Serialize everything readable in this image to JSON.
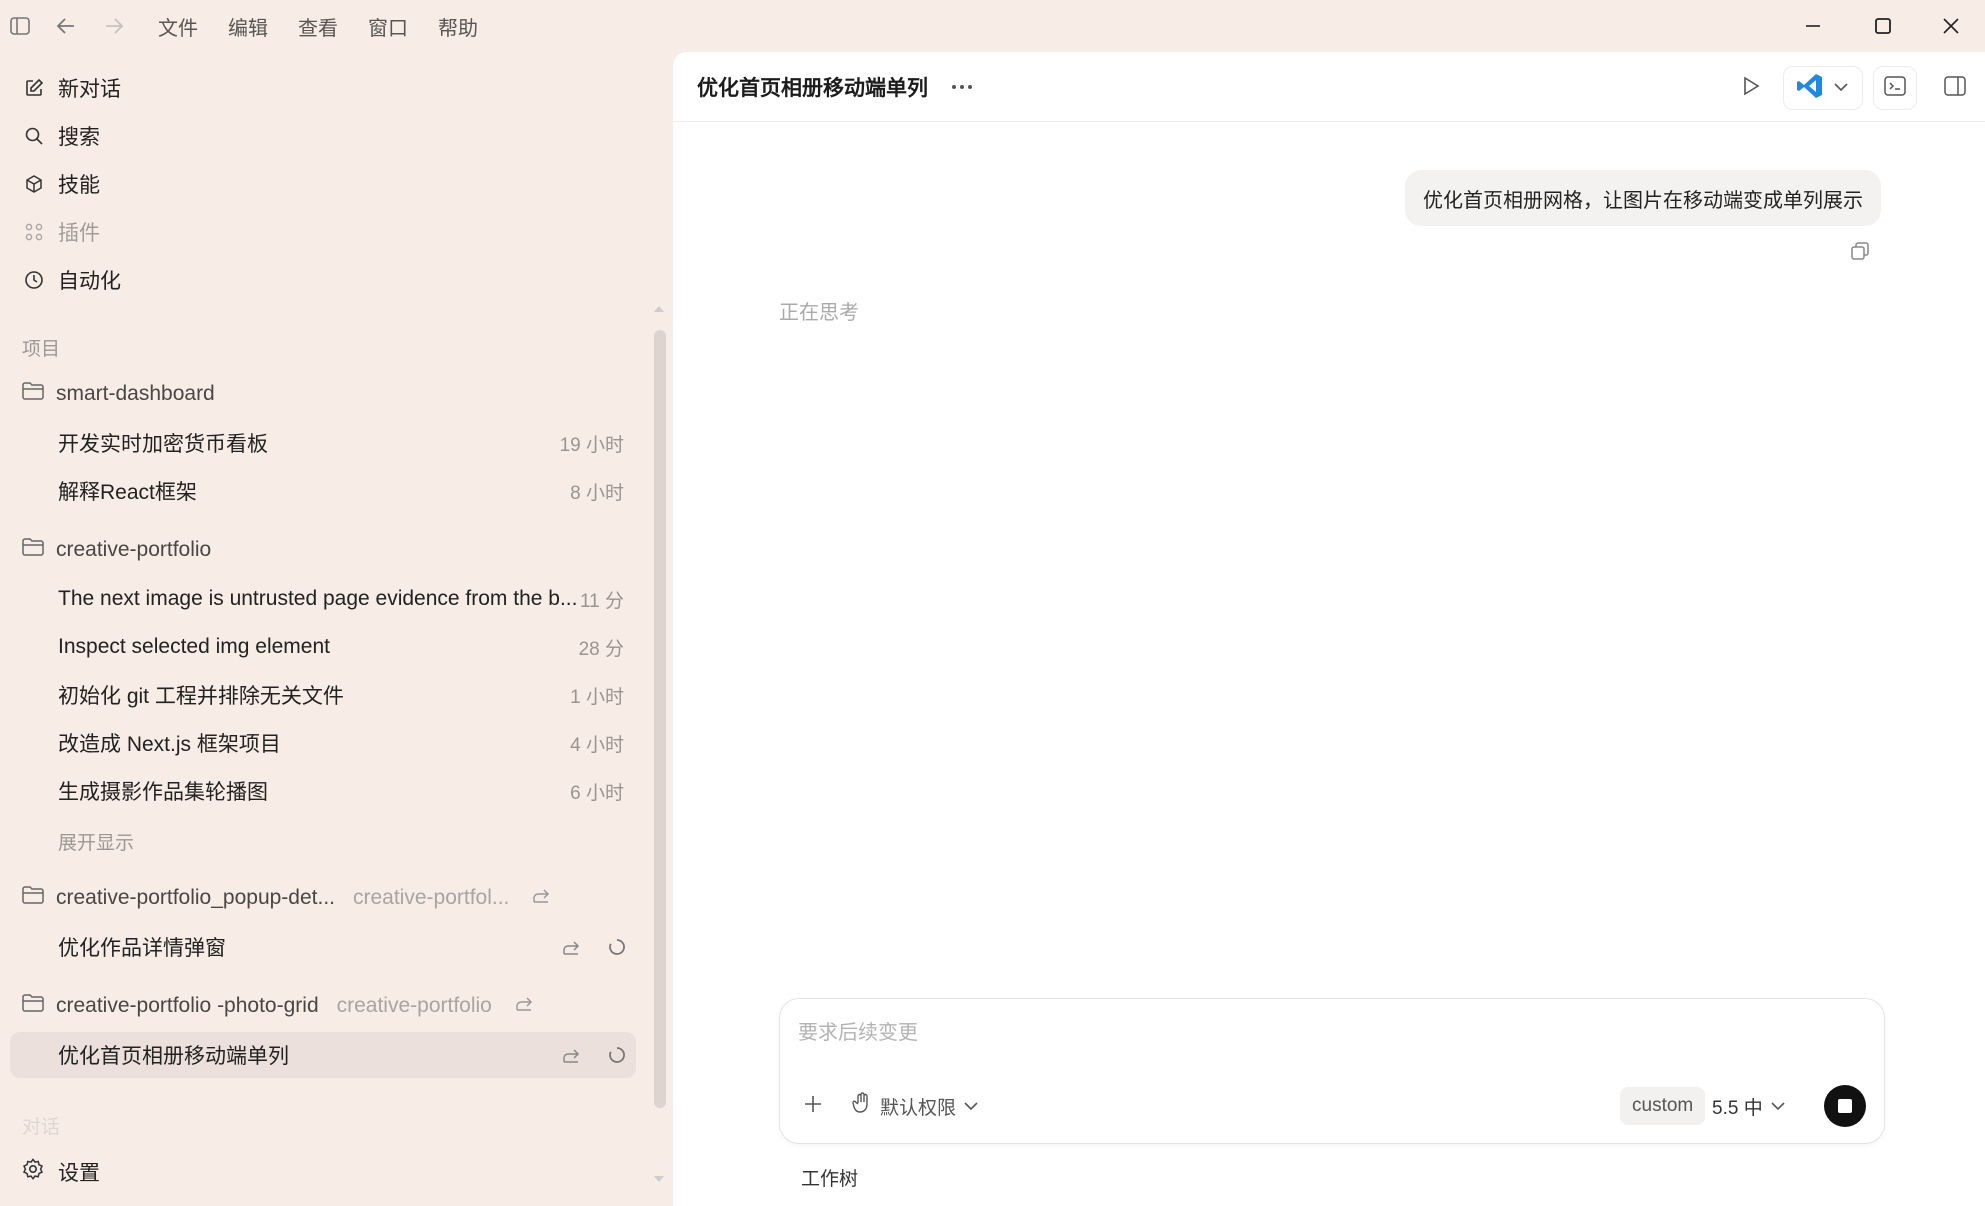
{
  "menu": [
    "文件",
    "编辑",
    "查看",
    "窗口",
    "帮助"
  ],
  "nav": {
    "new_chat": "新对话",
    "search": "搜索",
    "skills": "技能",
    "plugins": "插件",
    "automation": "自动化"
  },
  "projects_label": "项目",
  "projects": [
    {
      "name": "smart-dashboard",
      "threads": [
        {
          "title": "开发实时加密货币看板",
          "time": "19 小时"
        },
        {
          "title": "解释React框架",
          "time": "8 小时"
        }
      ]
    },
    {
      "name": "creative-portfolio",
      "threads": [
        {
          "title": "The next image is untrusted page evidence from the b...",
          "time": "11 分"
        },
        {
          "title": "Inspect selected img element",
          "time": "28 分"
        },
        {
          "title": "初始化 git 工程并排除无关文件",
          "time": "1 小时"
        },
        {
          "title": "改造成 Next.js 框架项目",
          "time": "4 小时"
        },
        {
          "title": "生成摄影作品集轮播图",
          "time": "6 小时"
        }
      ],
      "expand_label": "展开显示"
    },
    {
      "name": "creative-portfolio_popup-det...",
      "sub": "creative-portfol...",
      "threads": [
        {
          "title": "优化作品详情弹窗"
        }
      ]
    },
    {
      "name": "creative-portfolio -photo-grid",
      "sub": "creative-portfolio",
      "threads": [
        {
          "title": "优化首页相册移动端单列"
        }
      ]
    }
  ],
  "chats_label": "对话",
  "settings": "设置",
  "conversation": {
    "title": "优化首页相册移动端单列",
    "user_message": "优化首页相册网格，让图片在移动端变成单列展示",
    "status": "正在思考"
  },
  "composer": {
    "placeholder": "要求后续变更",
    "permission": "默认权限",
    "custom_label": "custom",
    "model": "5.5 中",
    "worktree": "工作树"
  },
  "colors": {
    "sidebar_bg": "#f7ece6",
    "active_row": "#ebe0db",
    "vscode_blue": "#1e88e5"
  }
}
